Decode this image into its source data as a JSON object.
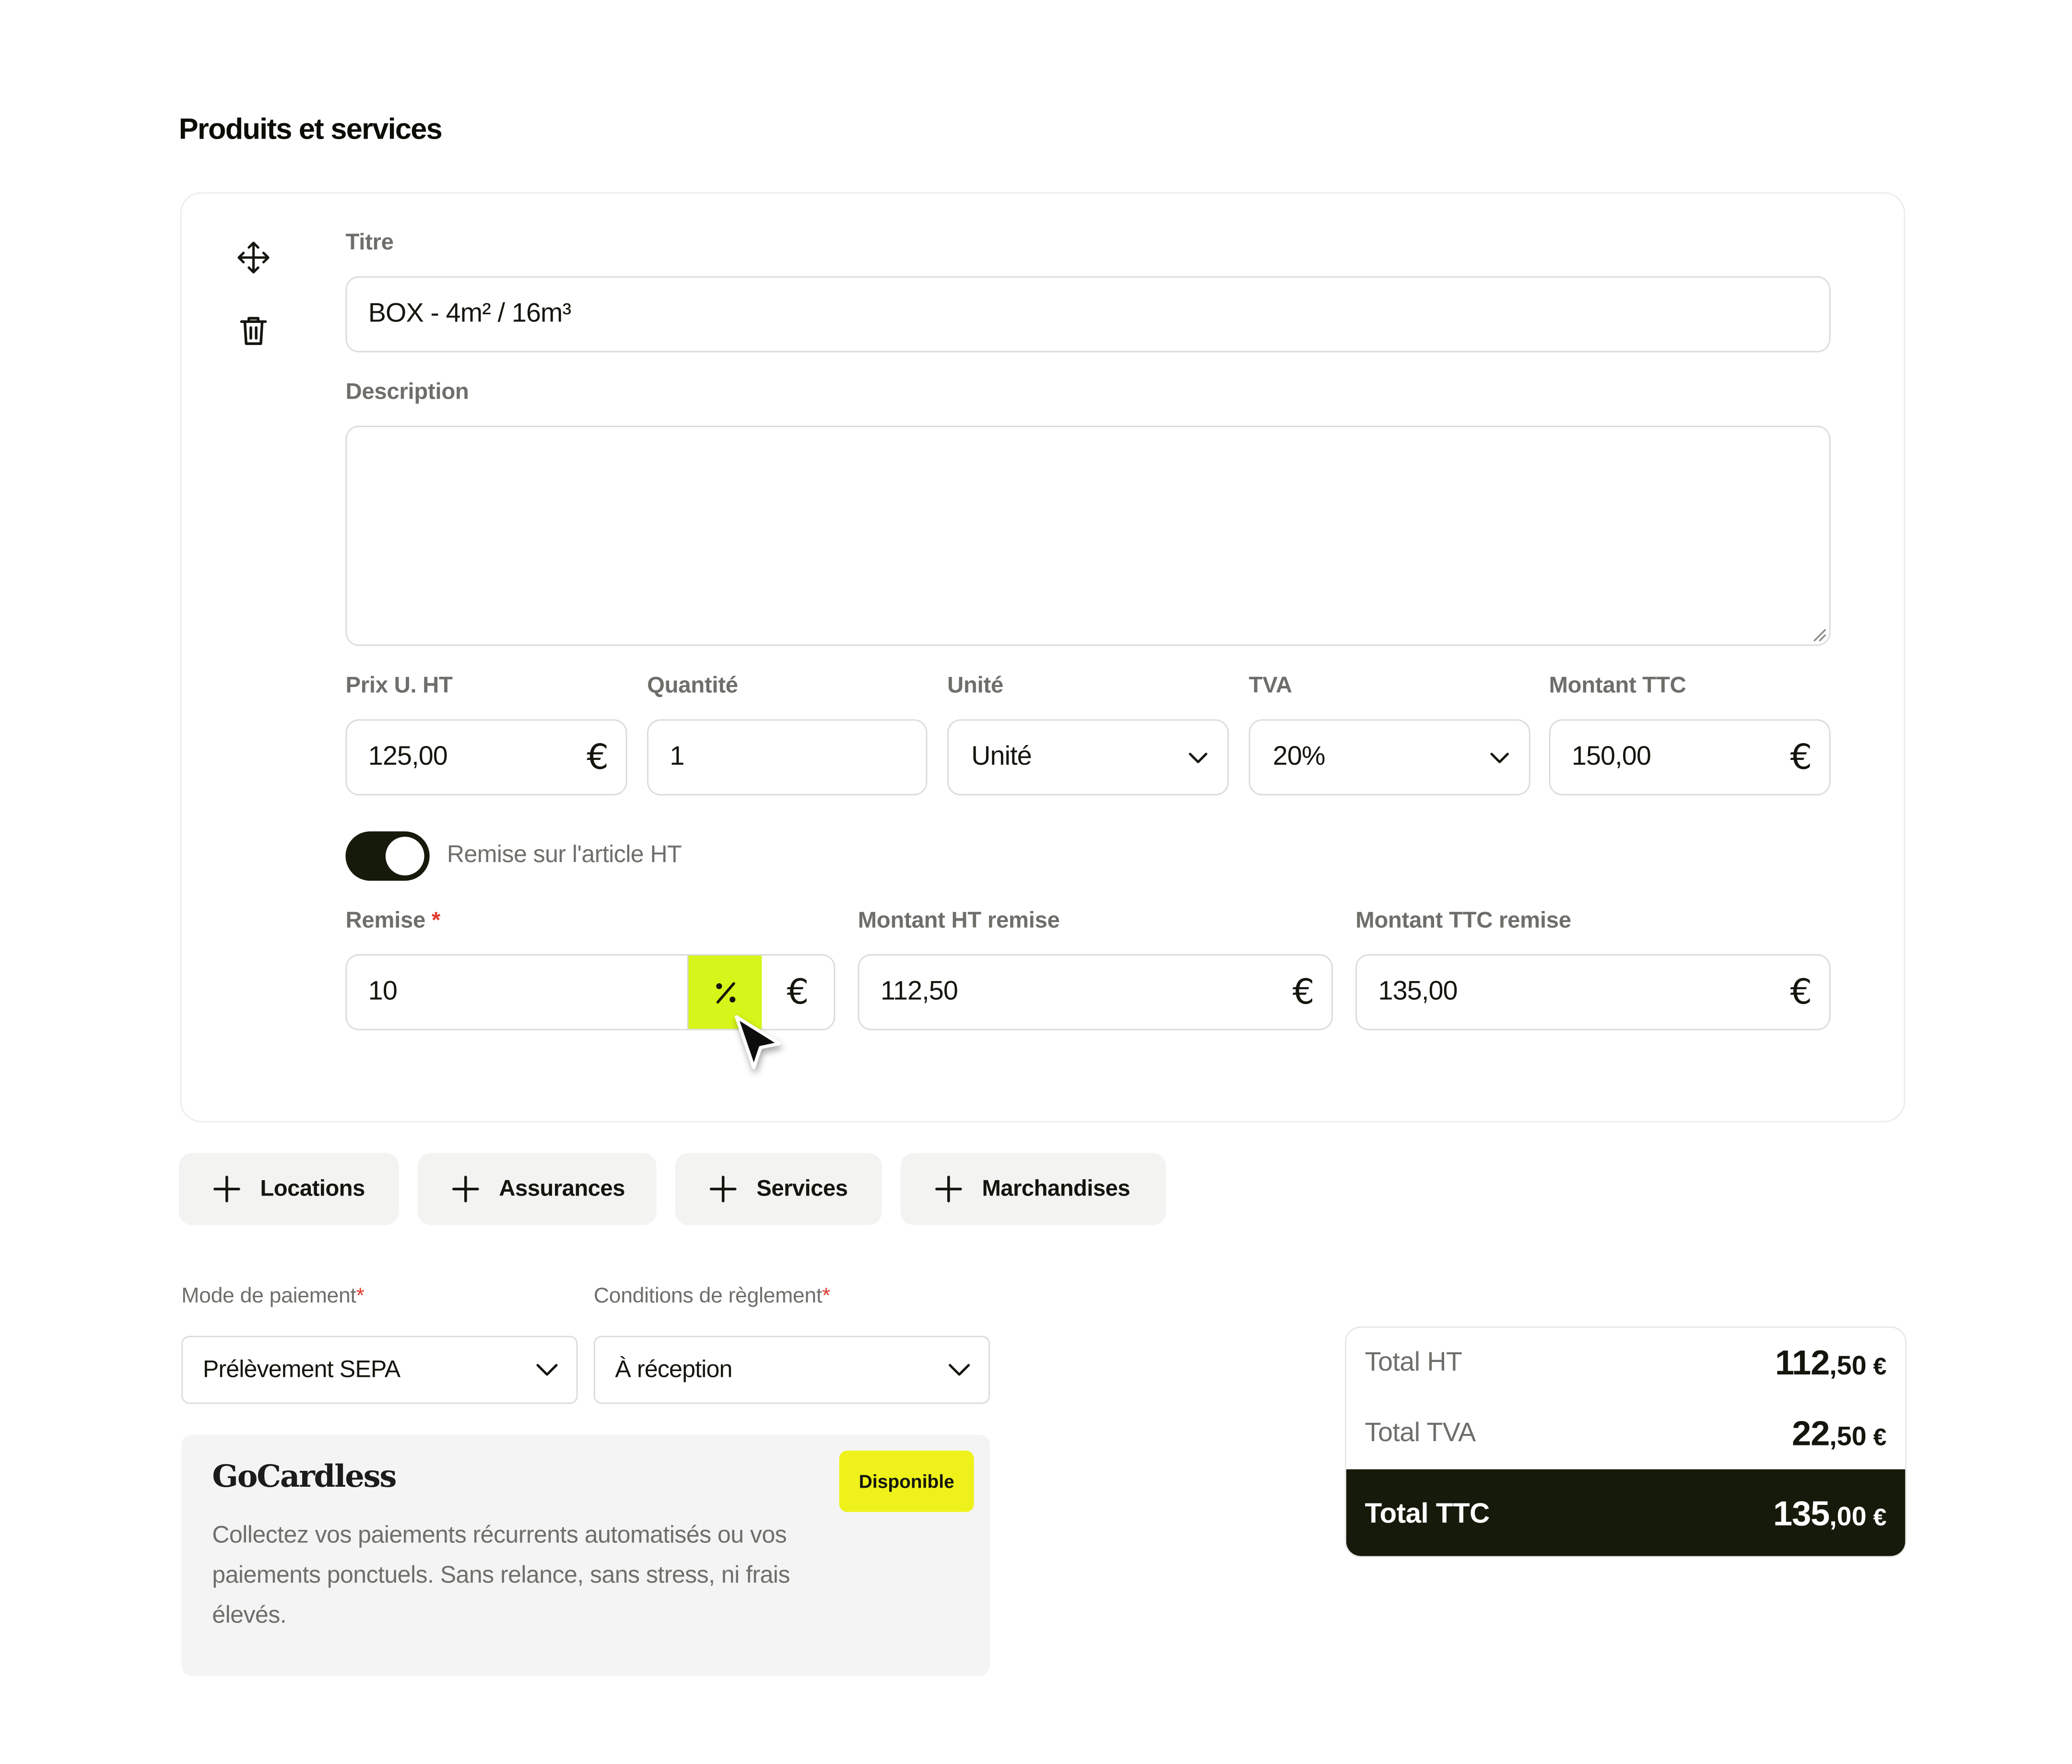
{
  "section": {
    "title": "Produits et services"
  },
  "item": {
    "title_label": "Titre",
    "title_value": "BOX - 4m² / 16m³",
    "description_label": "Description",
    "description_value": "",
    "price_label": "Prix U. HT",
    "price_value": "125,00",
    "quantity_label": "Quantité",
    "quantity_value": "1",
    "unit_label": "Unité",
    "unit_value": "Unité",
    "vat_label": "TVA",
    "vat_value": "20%",
    "ttc_label": "Montant TTC",
    "ttc_value": "150,00",
    "currency_symbol": "€",
    "discount_toggle_label": "Remise sur l'article HT",
    "discount_toggle_on": true,
    "discount_label": "Remise",
    "required_mark": "*",
    "discount_value": "10",
    "discount_mode_percent": "%",
    "discount_mode_euro": "€",
    "ht_discount_label": "Montant HT remise",
    "ht_discount_value": "112,50",
    "ttc_discount_label": "Montant TTC remise",
    "ttc_discount_value": "135,00"
  },
  "add_buttons": [
    {
      "label": "Locations"
    },
    {
      "label": "Assurances"
    },
    {
      "label": "Services"
    },
    {
      "label": "Marchandises"
    }
  ],
  "payment": {
    "mode_label": "Mode de paiement",
    "mode_value": "Prélèvement SEPA",
    "conditions_label": "Conditions de règlement",
    "conditions_value": "À réception",
    "required_mark": "*"
  },
  "gocardless": {
    "logo": "GoCardless",
    "badge": "Disponible",
    "text": "Collectez vos paiements récurrents automatisés ou vos paiements ponctuels. Sans relance, sans stress, ni frais élevés."
  },
  "totals": {
    "ht_label": "Total HT",
    "ht_int": "112",
    "ht_dec": ",50",
    "tva_label": "Total TVA",
    "tva_int": "22",
    "tva_dec": ",50",
    "ttc_label": "Total TTC",
    "ttc_int": "135",
    "ttc_dec": ",00",
    "currency": "€"
  },
  "colors": {
    "accent_lime": "#d6f51a",
    "badge_yellow": "#eef21a",
    "dark": "#161a0a",
    "required_red": "#e23a2e"
  },
  "icons": [
    "move-icon",
    "trash-icon",
    "chevron-down-icon",
    "plus-icon",
    "percent-icon",
    "cursor-pointer-icon"
  ]
}
